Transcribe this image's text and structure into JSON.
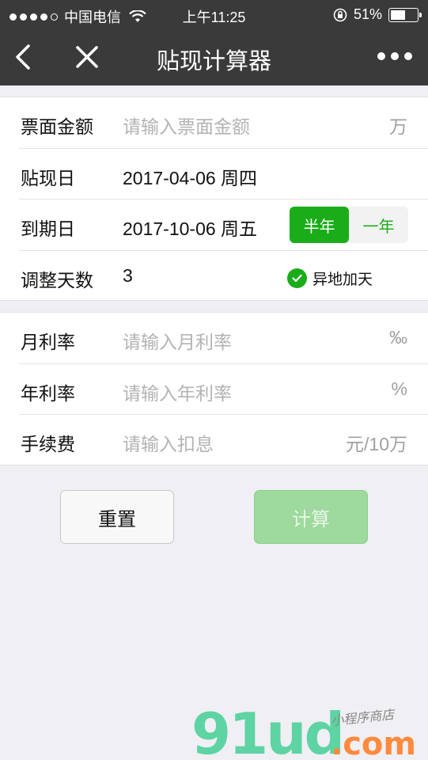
{
  "status_bar": {
    "carrier": "中国电信",
    "time": "上午11:25",
    "battery": "51%",
    "battery_level": 0.51
  },
  "nav": {
    "title": "贴现计算器"
  },
  "form": {
    "amount": {
      "label": "票面金额",
      "placeholder": "请输入票面金额",
      "unit": "万"
    },
    "discount_date": {
      "label": "贴现日",
      "value": "2017-04-06 周四"
    },
    "due_date": {
      "label": "到期日",
      "value": "2017-10-06 周五",
      "options": [
        "半年",
        "一年"
      ],
      "selected": "半年"
    },
    "adjust_days": {
      "label": "调整天数",
      "value": "3",
      "checkbox_label": "异地加天",
      "checked": true
    },
    "monthly_rate": {
      "label": "月利率",
      "placeholder": "请输入月利率",
      "unit": "‰"
    },
    "annual_rate": {
      "label": "年利率",
      "placeholder": "请输入年利率",
      "unit": "%"
    },
    "fee": {
      "label": "手续费",
      "placeholder": "请输入扣息",
      "unit": "元/10万"
    }
  },
  "buttons": {
    "reset": "重置",
    "calculate": "计算"
  },
  "watermark": {
    "brand": "91ud",
    "domain": ".com",
    "tagline": "小程序商店"
  },
  "colors": {
    "accent": "#1aad19",
    "header": "#3a3a3a",
    "background": "#efeff4"
  }
}
